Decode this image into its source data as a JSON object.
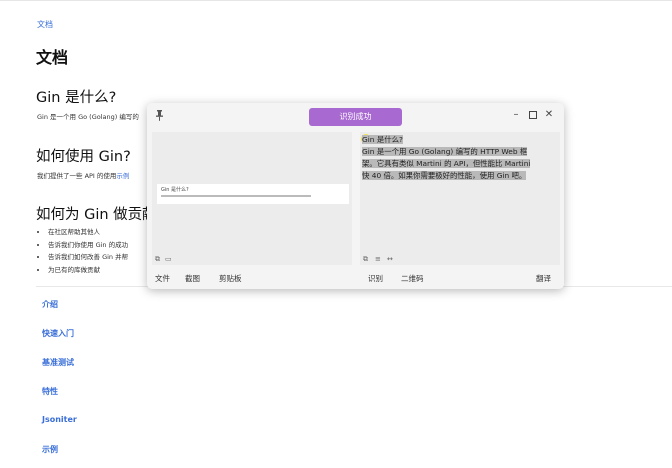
{
  "doc": {
    "breadcrumb": "文档",
    "title": "文档",
    "sections": [
      {
        "heading": "Gin 是什么?",
        "text": "Gin 是一个用 Go (Golang) 编写的"
      },
      {
        "heading": "如何使用 Gin?",
        "text_before": "我们提供了一些 API 的使用",
        "link": "示例"
      },
      {
        "heading": "如何为 Gin 做贡献"
      }
    ],
    "bullets": [
      "在社区帮助其他人",
      "告诉我们你使用 Gin 的成功",
      "告诉我们如何改善 Gin 并帮",
      "为已有的库做贡献"
    ],
    "nav": [
      "介绍",
      "快速入门",
      "基准测试",
      "特性",
      "Jsoniter",
      "示例"
    ]
  },
  "dialog": {
    "status": "识别成功",
    "pin_icon": "pin-icon",
    "ocr_lines": [
      "Gin 是什么?",
      "Gin 是一个用 Go (Golang) 编写的 HTTP Web 框",
      "架。它具有类似 Martini 的 API，但性能比 Martini",
      "快 40 倍。如果你需要极好的性能，使用 Gin 吧。"
    ],
    "preview_title": "Gin 是什么?",
    "footer_left": [
      "文件",
      "截图",
      "剪贴板"
    ],
    "footer_right": [
      "识别",
      "二维码"
    ],
    "translate": "翻译"
  }
}
